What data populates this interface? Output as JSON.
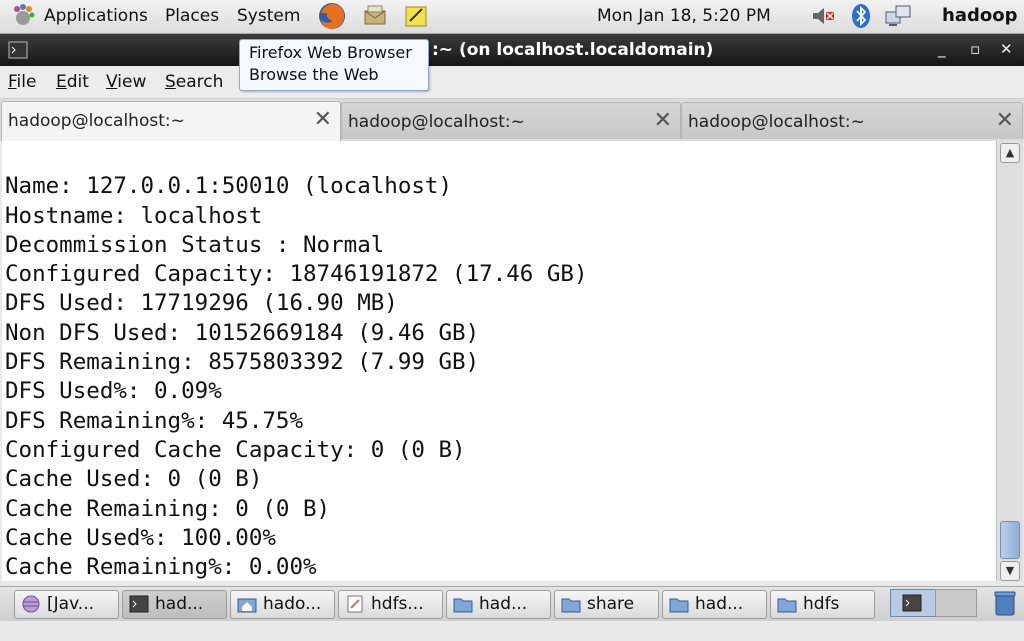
{
  "top_panel": {
    "menus": [
      "Applications",
      "Places",
      "System"
    ],
    "clock": "Mon Jan 18,  5:20 PM",
    "user": "hadoop"
  },
  "tooltip": {
    "line1": "Firefox Web Browser",
    "line2": "Browse the Web"
  },
  "window": {
    "title": ":~ (on localhost.localdomain)",
    "buttons": [
      "_",
      "▫",
      "✕"
    ]
  },
  "menubar": {
    "items": [
      {
        "mnemonic": "F",
        "rest": "ile"
      },
      {
        "mnemonic": "E",
        "rest": "dit"
      },
      {
        "mnemonic": "V",
        "rest": "iew"
      },
      {
        "mnemonic": "S",
        "rest": "earch"
      }
    ]
  },
  "tabs": [
    {
      "label": "hadoop@localhost:~",
      "close": "✕",
      "active": true
    },
    {
      "label": "hadoop@localhost:~",
      "close": "✕",
      "active": false
    },
    {
      "label": "hadoop@localhost:~",
      "close": "✕",
      "active": false
    }
  ],
  "terminal": {
    "lines": [
      "Name: 127.0.0.1:50010 (localhost)",
      "Hostname: localhost",
      "Decommission Status : Normal",
      "Configured Capacity: 18746191872 (17.46 GB)",
      "DFS Used: 17719296 (16.90 MB)",
      "Non DFS Used: 10152669184 (9.46 GB)",
      "DFS Remaining: 8575803392 (7.99 GB)",
      "DFS Used%: 0.09%",
      "DFS Remaining%: 45.75%",
      "Configured Cache Capacity: 0 (0 B)",
      "Cache Used: 0 (0 B)",
      "Cache Remaining: 0 (0 B)",
      "Cache Used%: 100.00%",
      "Cache Remaining%: 0.00%"
    ]
  },
  "scrollbar": {
    "up": "▲",
    "down": "▼"
  },
  "taskbar": [
    {
      "label": "[Jav...",
      "icon": "java-icon"
    },
    {
      "label": "had...",
      "icon": "terminal-icon"
    },
    {
      "label": "hado...",
      "icon": "home-folder-icon"
    },
    {
      "label": "hdfs...",
      "icon": "text-editor-icon"
    },
    {
      "label": "had...",
      "icon": "folder-icon"
    },
    {
      "label": "share",
      "icon": "folder-icon"
    },
    {
      "label": "had...",
      "icon": "folder-icon"
    },
    {
      "label": "hdfs",
      "icon": "folder-icon"
    }
  ],
  "colors": {
    "titlebar": "#222222",
    "tooltip_bg": "#f4f8ff",
    "scroll_thumb": "#8eb0da"
  }
}
